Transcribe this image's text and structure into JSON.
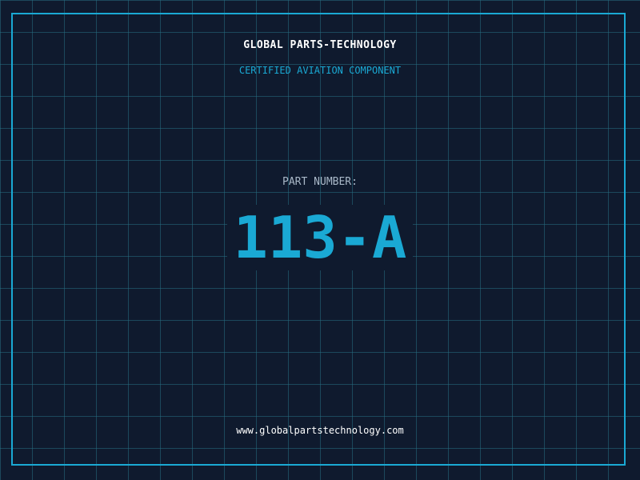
{
  "header": {
    "brand": "GLOBAL PARTS-TECHNOLOGY",
    "tagline": "CERTIFIED AVIATION COMPONENT"
  },
  "part": {
    "label": "PART NUMBER:",
    "number": "113-A"
  },
  "footer": {
    "url": "www.globalpartstechnology.com"
  },
  "colors": {
    "background": "#0f1a2e",
    "accent": "#1aa9d4",
    "grid": "#266e82",
    "text": "#ffffff",
    "muted": "#a9b8c8"
  }
}
